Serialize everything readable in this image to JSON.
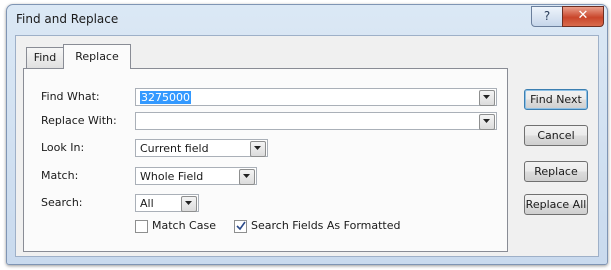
{
  "window": {
    "title": "Find and Replace",
    "help_glyph": "?",
    "close_glyph": "✕"
  },
  "tabs": [
    {
      "label": "Find",
      "active": false
    },
    {
      "label": "Replace",
      "active": true
    }
  ],
  "fields": {
    "find_what": {
      "label": "Find What:",
      "value": "3275000",
      "selected": true
    },
    "replace_with": {
      "label": "Replace With:",
      "value": ""
    },
    "look_in": {
      "label": "Look In:",
      "value": "Current field"
    },
    "match": {
      "label": "Match:",
      "value": "Whole Field"
    },
    "search": {
      "label": "Search:",
      "value": "All"
    }
  },
  "options": {
    "match_case": {
      "label": "Match Case",
      "checked": false
    },
    "search_formatted": {
      "label": "Search Fields As Formatted",
      "checked": true
    }
  },
  "buttons": {
    "find_next": "Find Next",
    "cancel": "Cancel",
    "replace": "Replace",
    "replace_all": "Replace All"
  },
  "icons": {
    "dropdown": "chevron-down-icon",
    "check": "check-icon"
  }
}
